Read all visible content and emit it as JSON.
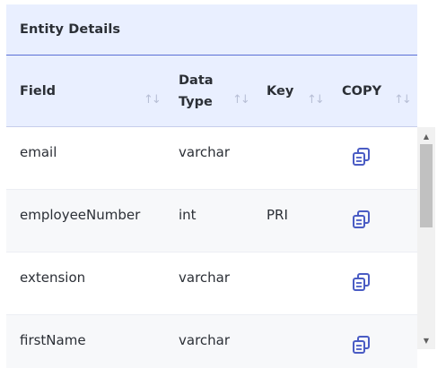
{
  "title": "Entity Details",
  "columns": [
    {
      "label": "Field"
    },
    {
      "label": "Data Type"
    },
    {
      "label": "Key"
    },
    {
      "label": "COPY"
    }
  ],
  "sort_glyph": "↑↓",
  "rows": [
    {
      "field": "email",
      "type": "varchar",
      "key": ""
    },
    {
      "field": "employeeNumber",
      "type": "int",
      "key": "PRI"
    },
    {
      "field": "extension",
      "type": "varchar",
      "key": ""
    },
    {
      "field": "firstName",
      "type": "varchar",
      "key": ""
    }
  ],
  "icons": {
    "copy": "copy-icon",
    "scroll_up": "scroll-up-arrow",
    "scroll_down": "scroll-down-arrow"
  },
  "colors": {
    "header_bg": "#e9efff",
    "accent": "#5a6fd6",
    "copy_icon": "#4a5cc4",
    "alt_row": "#f7f8fa"
  }
}
